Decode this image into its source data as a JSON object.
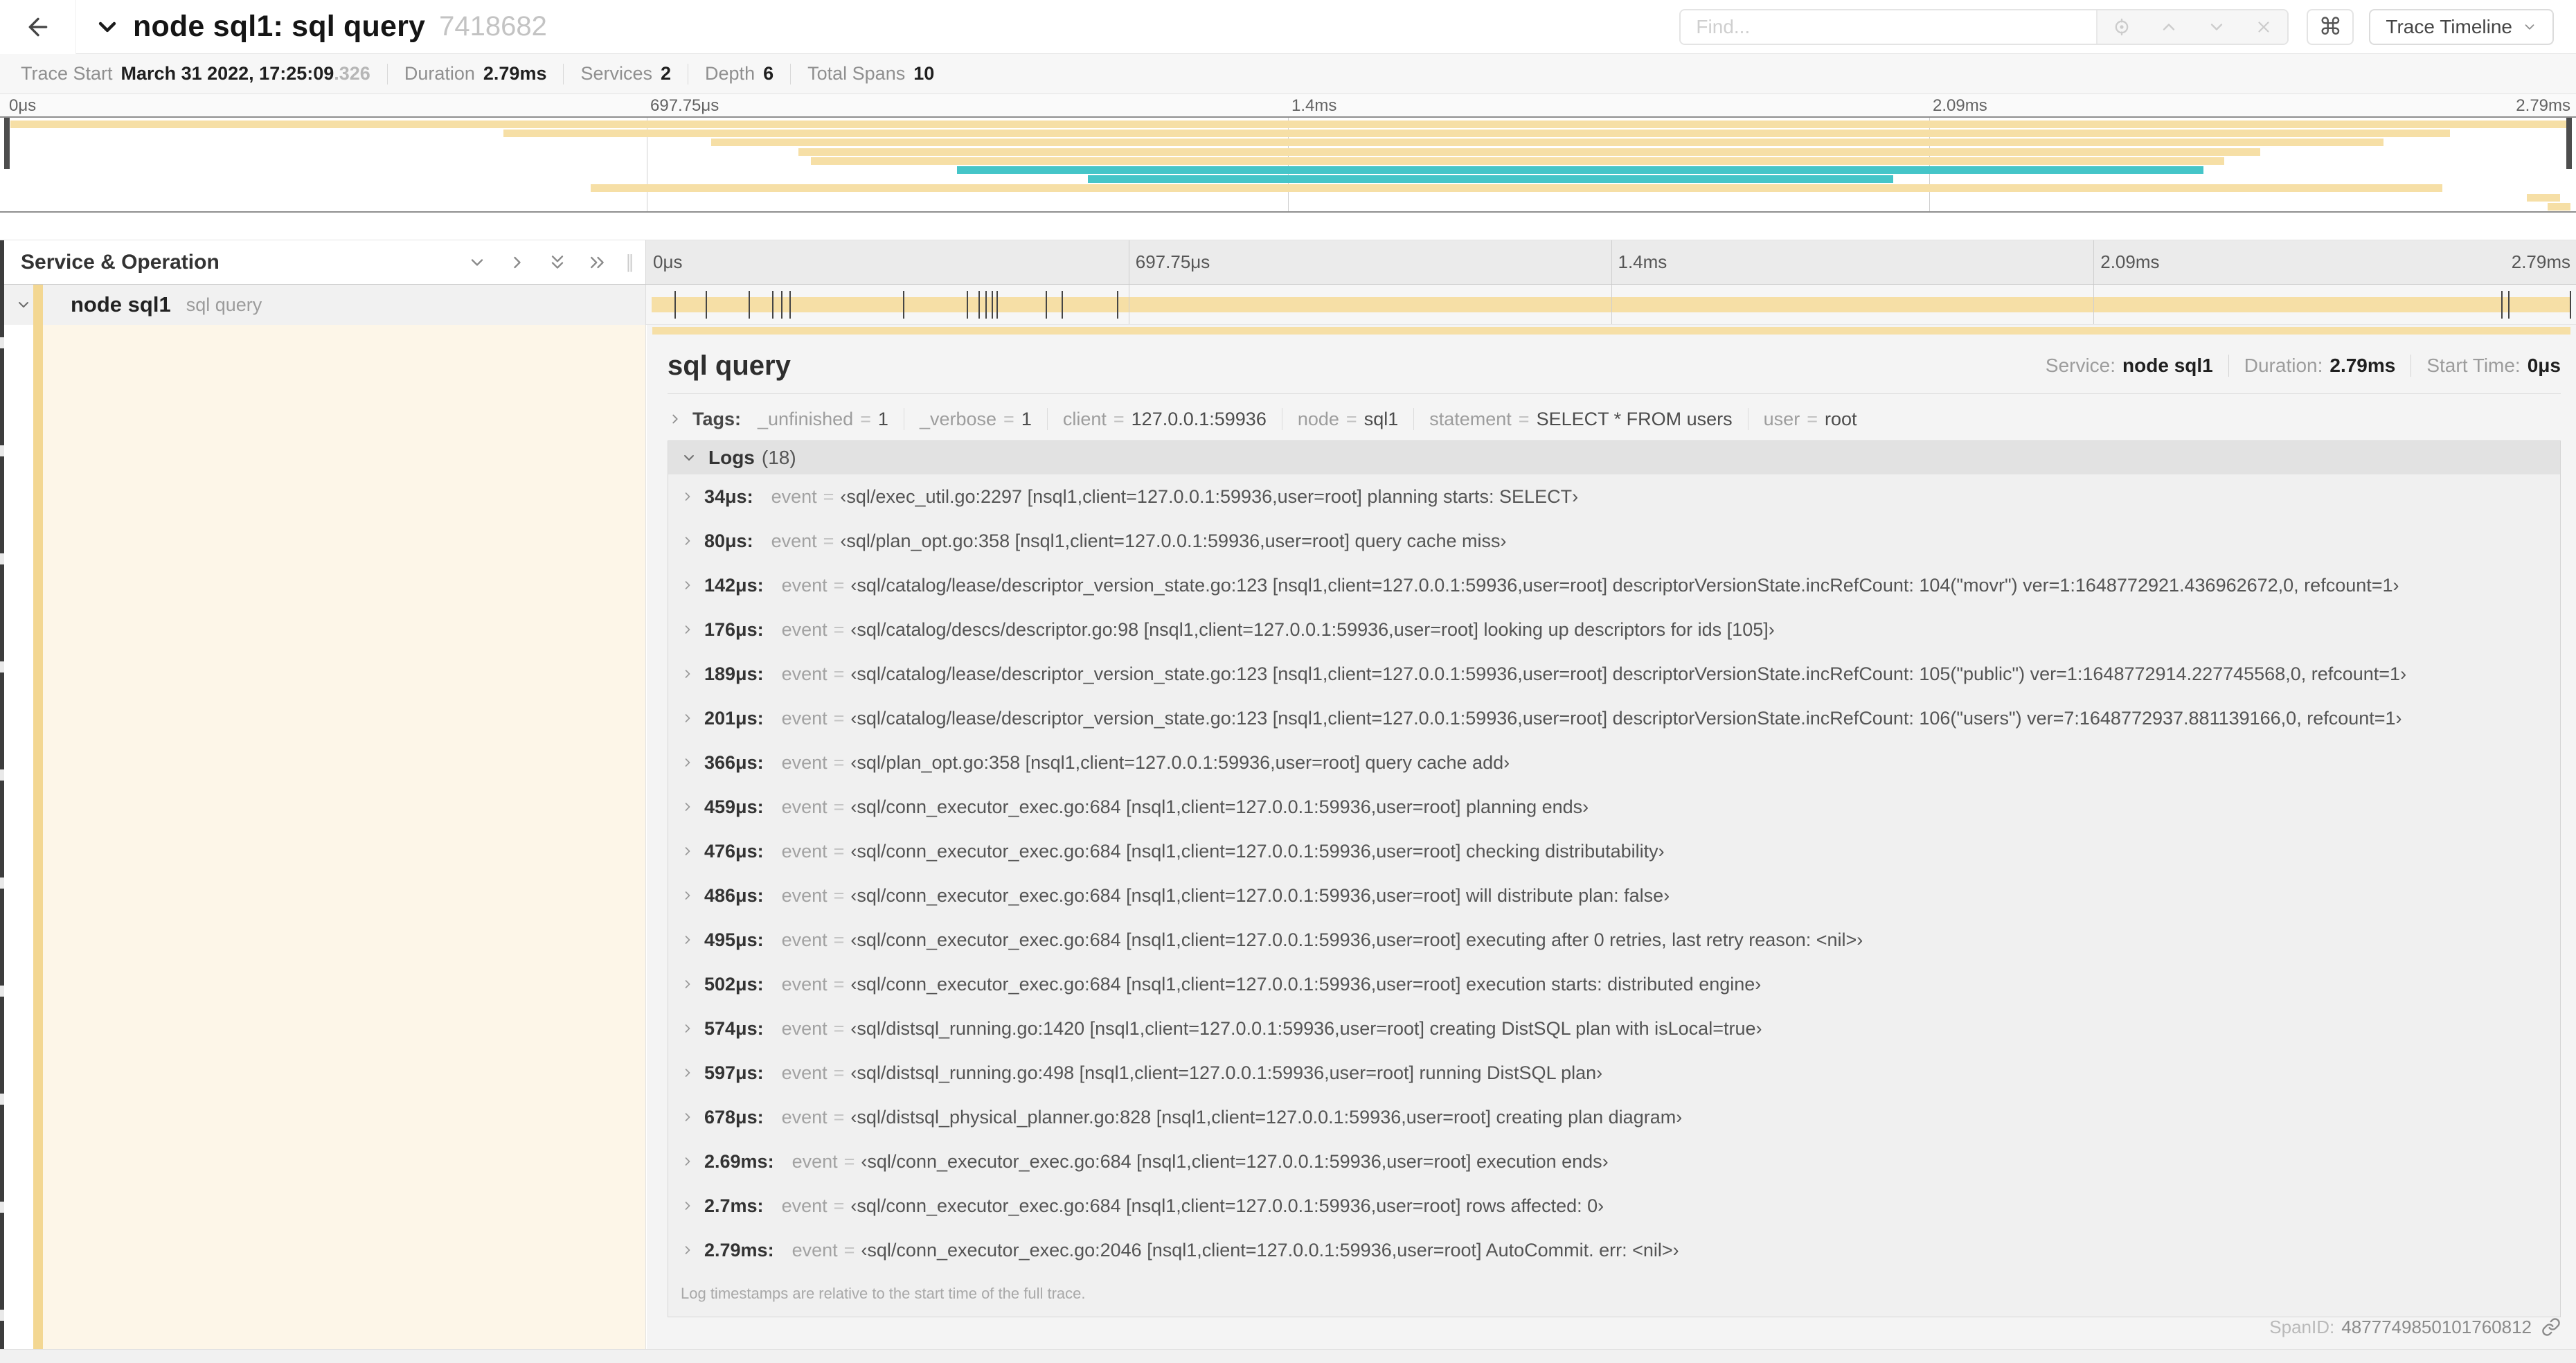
{
  "header": {
    "title": "node sql1: sql query",
    "trace_id": "7418682",
    "find_placeholder": "Find...",
    "shortcut_button": "⌘",
    "view_dropdown": "Trace Timeline"
  },
  "stats": [
    {
      "label": "Trace Start",
      "value": "March 31 2022, 17:25:09",
      "suffix": ".326"
    },
    {
      "label": "Duration",
      "value": "2.79ms",
      "suffix": ""
    },
    {
      "label": "Services",
      "value": "2",
      "suffix": ""
    },
    {
      "label": "Depth",
      "value": "6",
      "suffix": ""
    },
    {
      "label": "Total Spans",
      "value": "10",
      "suffix": ""
    }
  ],
  "ruler_ticks": [
    "0μs",
    "697.75μs",
    "1.4ms",
    "2.09ms",
    "2.79ms"
  ],
  "colors": {
    "tan": "#f6dfa6",
    "teal": "#45c5c8",
    "accent_tan": "#f3d792",
    "cream": "#fdf6e8"
  },
  "minimap": {
    "spans": [
      {
        "s": 0.002,
        "e": 1.0,
        "c": "tan"
      },
      {
        "s": 0.194,
        "e": 0.953,
        "c": "tan"
      },
      {
        "s": 0.275,
        "e": 0.927,
        "c": "tan"
      },
      {
        "s": 0.309,
        "e": 0.879,
        "c": "tan"
      },
      {
        "s": 0.314,
        "e": 0.865,
        "c": "tan"
      },
      {
        "s": 0.371,
        "e": 0.857,
        "c": "teal"
      },
      {
        "s": 0.422,
        "e": 0.736,
        "c": "teal"
      },
      {
        "s": 0.228,
        "e": 0.95,
        "c": "tan"
      },
      {
        "s": 0.983,
        "e": 0.996,
        "c": "tan"
      },
      {
        "s": 0.991,
        "e": 1.0,
        "c": "tan"
      }
    ]
  },
  "timeline": {
    "column_header": "Service & Operation",
    "row": {
      "service": "node sql1",
      "operation": "sql query"
    },
    "total_us": 2790,
    "log_markers_us": [
      34,
      80,
      142,
      176,
      189,
      201,
      366,
      459,
      476,
      486,
      495,
      502,
      574,
      597,
      678,
      2690,
      2700,
      2790
    ]
  },
  "detail": {
    "title": "sql query",
    "meta": [
      {
        "label": "Service:",
        "value": "node sql1"
      },
      {
        "label": "Duration:",
        "value": "2.79ms"
      },
      {
        "label": "Start Time:",
        "value": "0μs"
      }
    ],
    "tags_label": "Tags:",
    "tags": [
      {
        "key": "_unfinished",
        "value": "1"
      },
      {
        "key": "_verbose",
        "value": "1"
      },
      {
        "key": "client",
        "value": "127.0.0.1:59936"
      },
      {
        "key": "node",
        "value": "sql1"
      },
      {
        "key": "statement",
        "value": "SELECT * FROM users"
      },
      {
        "key": "user",
        "value": "root"
      }
    ],
    "logs_label": "Logs",
    "logs_count": "(18)",
    "logs": [
      {
        "t": "34μs:",
        "k": "event",
        "v": "‹sql/exec_util.go:2297 [nsql1,client=127.0.0.1:59936,user=root] planning starts: SELECT›"
      },
      {
        "t": "80μs:",
        "k": "event",
        "v": "‹sql/plan_opt.go:358 [nsql1,client=127.0.0.1:59936,user=root] query cache miss›"
      },
      {
        "t": "142μs:",
        "k": "event",
        "v": "‹sql/catalog/lease/descriptor_version_state.go:123 [nsql1,client=127.0.0.1:59936,user=root] descriptorVersionState.incRefCount: 104(\"movr\") ver=1:1648772921.436962672,0, refcount=1›"
      },
      {
        "t": "176μs:",
        "k": "event",
        "v": "‹sql/catalog/descs/descriptor.go:98 [nsql1,client=127.0.0.1:59936,user=root] looking up descriptors for ids [105]›"
      },
      {
        "t": "189μs:",
        "k": "event",
        "v": "‹sql/catalog/lease/descriptor_version_state.go:123 [nsql1,client=127.0.0.1:59936,user=root] descriptorVersionState.incRefCount: 105(\"public\") ver=1:1648772914.227745568,0, refcount=1›"
      },
      {
        "t": "201μs:",
        "k": "event",
        "v": "‹sql/catalog/lease/descriptor_version_state.go:123 [nsql1,client=127.0.0.1:59936,user=root] descriptorVersionState.incRefCount: 106(\"users\") ver=7:1648772937.881139166,0, refcount=1›"
      },
      {
        "t": "366μs:",
        "k": "event",
        "v": "‹sql/plan_opt.go:358 [nsql1,client=127.0.0.1:59936,user=root] query cache add›"
      },
      {
        "t": "459μs:",
        "k": "event",
        "v": "‹sql/conn_executor_exec.go:684 [nsql1,client=127.0.0.1:59936,user=root] planning ends›"
      },
      {
        "t": "476μs:",
        "k": "event",
        "v": "‹sql/conn_executor_exec.go:684 [nsql1,client=127.0.0.1:59936,user=root] checking distributability›"
      },
      {
        "t": "486μs:",
        "k": "event",
        "v": "‹sql/conn_executor_exec.go:684 [nsql1,client=127.0.0.1:59936,user=root] will distribute plan: false›"
      },
      {
        "t": "495μs:",
        "k": "event",
        "v": "‹sql/conn_executor_exec.go:684 [nsql1,client=127.0.0.1:59936,user=root] executing after 0 retries, last retry reason: <nil>›"
      },
      {
        "t": "502μs:",
        "k": "event",
        "v": "‹sql/conn_executor_exec.go:684 [nsql1,client=127.0.0.1:59936,user=root] execution starts: distributed engine›"
      },
      {
        "t": "574μs:",
        "k": "event",
        "v": "‹sql/distsql_running.go:1420 [nsql1,client=127.0.0.1:59936,user=root] creating DistSQL plan with isLocal=true›"
      },
      {
        "t": "597μs:",
        "k": "event",
        "v": "‹sql/distsql_running.go:498 [nsql1,client=127.0.0.1:59936,user=root] running DistSQL plan›"
      },
      {
        "t": "678μs:",
        "k": "event",
        "v": "‹sql/distsql_physical_planner.go:828 [nsql1,client=127.0.0.1:59936,user=root] creating plan diagram›"
      },
      {
        "t": "2.69ms:",
        "k": "event",
        "v": "‹sql/conn_executor_exec.go:684 [nsql1,client=127.0.0.1:59936,user=root] execution ends›"
      },
      {
        "t": "2.7ms:",
        "k": "event",
        "v": "‹sql/conn_executor_exec.go:684 [nsql1,client=127.0.0.1:59936,user=root] rows affected: 0›"
      },
      {
        "t": "2.79ms:",
        "k": "event",
        "v": "‹sql/conn_executor_exec.go:2046 [nsql1,client=127.0.0.1:59936,user=root] AutoCommit. err: <nil>›"
      }
    ],
    "logs_note": "Log timestamps are relative to the start time of the full trace.",
    "spanid_label": "SpanID:",
    "spanid_value": "4877749850101760812"
  }
}
